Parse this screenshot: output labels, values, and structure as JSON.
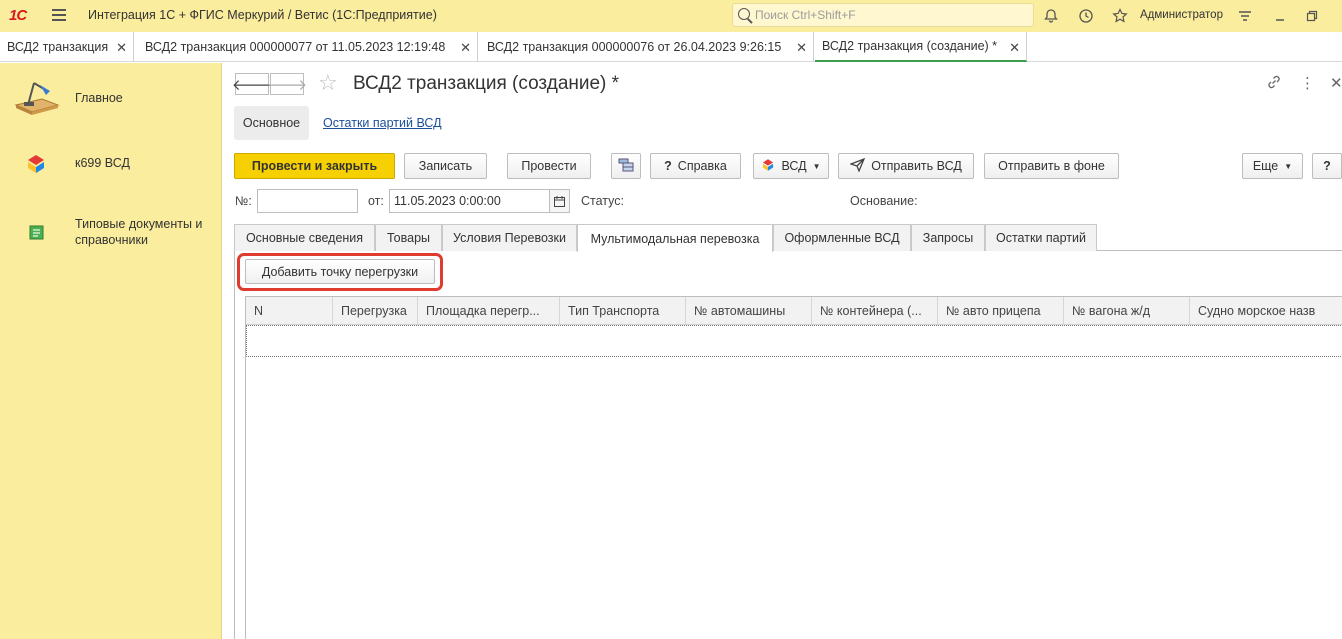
{
  "topbar": {
    "logo": "1С",
    "title": "Интеграция 1С + ФГИС Меркурий / Ветис  (1С:Предприятие)",
    "search_placeholder": "Поиск Ctrl+Shift+F",
    "user": "Администратор"
  },
  "window_tabs": [
    {
      "label": "ВСД2 транзакция"
    },
    {
      "label": "ВСД2 транзакция 000000077 от 11.05.2023 12:19:48"
    },
    {
      "label": "ВСД2 транзакция 000000076 от 26.04.2023 9:26:15"
    },
    {
      "label": "ВСД2 транзакция (создание) *"
    }
  ],
  "sidebar": {
    "items": [
      {
        "label": "Главное"
      },
      {
        "label": "к699 ВСД"
      },
      {
        "label": "Типовые документы и справочники"
      }
    ]
  },
  "form": {
    "title": "ВСД2 транзакция (создание) *",
    "section_main": "Основное",
    "section_link": "Остатки партий ВСД",
    "buttons": {
      "post_close": "Провести и закрыть",
      "save": "Записать",
      "post": "Провести",
      "help": "Справка",
      "vsd": "ВСД",
      "send_vsd": "Отправить ВСД",
      "send_bg": "Отправить в фоне",
      "more": "Еще",
      "question": "?"
    },
    "fields": {
      "number_label": "№:",
      "number_value": "",
      "date_label": "от:",
      "date_value": "11.05.2023  0:00:00",
      "status_label": "Статус:",
      "basis_label": "Основание:"
    },
    "tabs": [
      {
        "label": "Основные сведения"
      },
      {
        "label": "Товары"
      },
      {
        "label": "Условия Перевозки"
      },
      {
        "label": "Мультимодальная перевозка"
      },
      {
        "label": "Оформленные ВСД"
      },
      {
        "label": "Запросы"
      },
      {
        "label": "Остатки партий"
      }
    ],
    "add_point_button": "Добавить точку перегрузки",
    "grid_columns": [
      "N",
      "Перегрузка",
      "Площадка перегр...",
      "Тип Транспорта",
      "№ автомашины",
      "№ контейнера (...",
      "№ авто прицепа",
      "№ вагона ж/д",
      "Судно морское назв"
    ]
  },
  "colors": {
    "topbar_bg": "#fbed9e",
    "primary_button": "#f6d000",
    "highlight": "#e03b2f",
    "link": "#1b4f9a"
  }
}
